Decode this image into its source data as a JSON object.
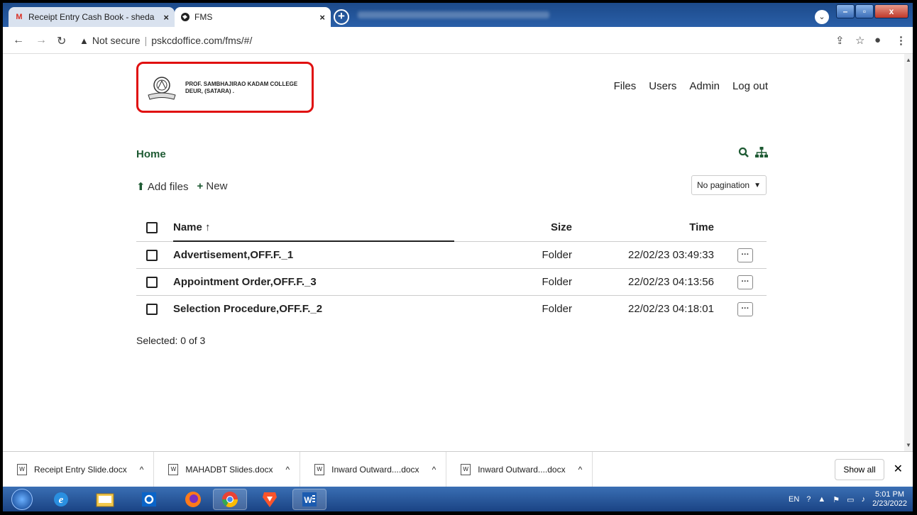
{
  "browser": {
    "tabs": [
      {
        "title": "Receipt Entry Cash Book - sheda",
        "favicon": "gmail-icon"
      },
      {
        "title": "FMS",
        "favicon": "globe-icon"
      }
    ],
    "address": {
      "security": "Not secure",
      "url": "pskcdoffice.com/fms/#/"
    }
  },
  "header": {
    "college_line1": "PROF. SAMBHAJIRAO KADAM COLLEGE",
    "college_line2": "DEUR, (SATARA) .",
    "nav": [
      "Files",
      "Users",
      "Admin",
      "Log out"
    ]
  },
  "main": {
    "breadcrumb": "Home",
    "add_files": "Add files",
    "new": "New",
    "pagination": "No pagination",
    "columns": {
      "name": "Name",
      "size": "Size",
      "time": "Time"
    },
    "rows": [
      {
        "name": "Advertisement,OFF.F._1",
        "size": "Folder",
        "time": "22/02/23 03:49:33"
      },
      {
        "name": "Appointment Order,OFF.F._3",
        "size": "Folder",
        "time": "22/02/23 04:13:56"
      },
      {
        "name": "Selection Procedure,OFF.F._2",
        "size": "Folder",
        "time": "22/02/23 04:18:01"
      }
    ],
    "selected": "Selected: 0 of 3"
  },
  "downloads": {
    "items": [
      "Receipt Entry Slide.docx",
      "MAHADBT Slides.docx",
      "Inward Outward....docx",
      "Inward Outward....docx"
    ],
    "show_all": "Show all"
  },
  "taskbar": {
    "lang": "EN",
    "time": "5:01 PM",
    "date": "2/23/2022"
  }
}
